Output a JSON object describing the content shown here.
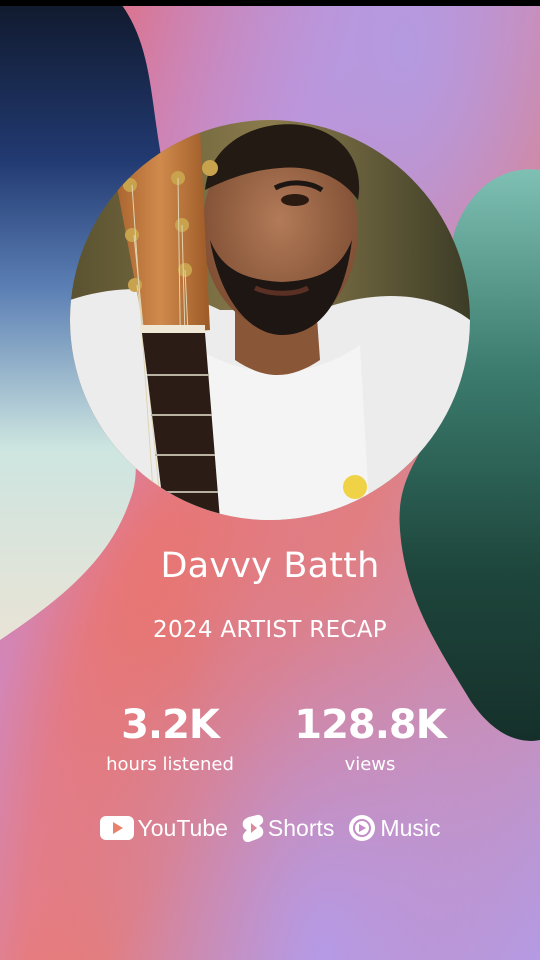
{
  "artist": {
    "name": "Davvy Batth",
    "photo_alt": "Artist portrait with guitar"
  },
  "recap": {
    "title": "2024 ARTIST RECAP"
  },
  "stats": [
    {
      "value": "3.2K",
      "label": "hours listened"
    },
    {
      "value": "128.8K",
      "label": "views"
    }
  ],
  "brands": [
    {
      "icon": "youtube-icon",
      "label": "YouTube"
    },
    {
      "icon": "shorts-icon",
      "label": "Shorts"
    },
    {
      "icon": "music-icon",
      "label": "Music"
    }
  ],
  "colors": {
    "coral": "#ef6a55",
    "lavender": "#b49ae0",
    "navy": "#233f78",
    "teal": "#2f6e62",
    "text": "#ffffff"
  }
}
